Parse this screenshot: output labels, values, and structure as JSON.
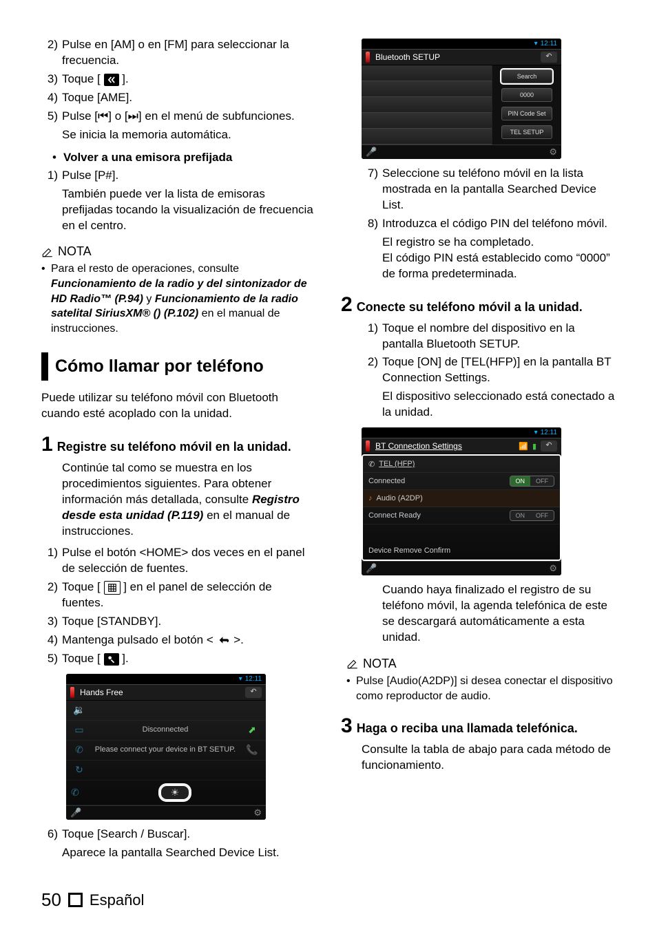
{
  "col1": {
    "l2_num": "2)",
    "l2_txt": "Pulse en [AM] o en [FM] para seleccionar la frecuencia.",
    "l3_num": "3)",
    "l3_txt_a": "Toque [",
    "l3_txt_b": "].",
    "l4_num": "4)",
    "l4_txt": "Toque [AME].",
    "l5_num": "5)",
    "l5_txt": "Pulse [⏮] o [⏭] en el menú de subfunciones.",
    "l5_sub": "Se inicia la memoria automática.",
    "preset_heading": "Volver a una emisora prefijada",
    "p1_num": "1)",
    "p1_txt": "Pulse [P#].",
    "p1_sub": "También puede ver la lista de emisoras prefijadas tocando la visualización de frecuencia en el centro.",
    "nota_label": "NOTA",
    "nota_a": "Para el resto de operaciones, consulte ",
    "nota_b": "Funcionamiento de la radio y del sintonizador de HD Radio™ (P.94)",
    "nota_c": " y ",
    "nota_d": "Funcionamiento de la radio satelital SiriusXM® () (P.102)",
    "nota_e": " en el manual de instrucciones.",
    "section_title": "Cómo llamar por teléfono",
    "intro": "Puede utilizar su teléfono móvil con Bluetooth cuando esté acoplado con la unidad.",
    "step1_num": "1",
    "step1_title": "Registre su teléfono móvil en la unidad.",
    "step1_body_a": "Continúe tal como se muestra en los procedimientos siguientes. Para obtener información más detallada, consulte ",
    "step1_body_b": "Registro desde esta unidad (P.119)",
    "step1_body_c": " en el manual de instrucciones.",
    "s1_1": "Pulse el botón <HOME> dos veces en el panel de selección de fuentes.",
    "s1_2a": "Toque [",
    "s1_2b": "] en el panel de selección de fuentes.",
    "s1_3": "Toque [STANDBY].",
    "s1_4a": "Mantenga pulsado el botón <",
    "s1_4b": ">.",
    "s1_5a": "Toque [",
    "s1_5b": "].",
    "ss_time": "12:11",
    "ss_hf_title": "Hands Free",
    "ss_hf_disconnected": "Disconnected",
    "ss_hf_please": "Please connect your device in BT SETUP.",
    "s1_6": "Toque [Search / Buscar].",
    "s1_6_sub": "Aparece la pantalla Searched Device List."
  },
  "col2": {
    "ss_time": "12:11",
    "ss_bt_title": "Bluetooth SETUP",
    "btn_search": "Search",
    "btn_pin": "0000",
    "btn_pincodeset": "PIN Code Set",
    "btn_telsetup": "TEL SETUP",
    "s1_7": "Seleccione su teléfono móvil en la lista mostrada en la pantalla Searched Device List.",
    "s1_8": "Introduzca el código PIN del teléfono móvil.",
    "s1_8_sub1": "El registro se ha completado.",
    "s1_8_sub2": "El código PIN está establecido como “0000” de forma predeterminada.",
    "step2_num": "2",
    "step2_title": "Conecte su teléfono móvil a la unidad.",
    "s2_1": "Toque el nombre del dispositivo en la pantalla Bluetooth SETUP.",
    "s2_2": "Toque [ON] de [TEL(HFP)] en la pantalla BT Connection Settings.",
    "s2_2_sub": "El dispositivo seleccionado está conectado a la unidad.",
    "ss_cs_title": "BT Connection Settings",
    "ss_tel_hfp": "TEL (HFP)",
    "ss_connected": "Connected",
    "ss_audio": "Audio (A2DP)",
    "ss_connect_ready": "Connect Ready",
    "ss_on": "ON",
    "ss_off": "OFF",
    "ss_remove": "Device Remove Confirm",
    "s2_after": "Cuando haya finalizado el registro de su teléfono móvil, la agenda telefónica de este se descargará automáticamente a esta unidad.",
    "nota_label": "NOTA",
    "nota_txt": "Pulse [Audio(A2DP)] si desea conectar el dispositivo como reproductor de audio.",
    "step3_num": "3",
    "step3_title": "Haga o reciba una llamada telefónica.",
    "step3_body": "Consulte la tabla de abajo para cada método de funcionamiento."
  },
  "footer": {
    "page": "50",
    "lang": "Español"
  }
}
